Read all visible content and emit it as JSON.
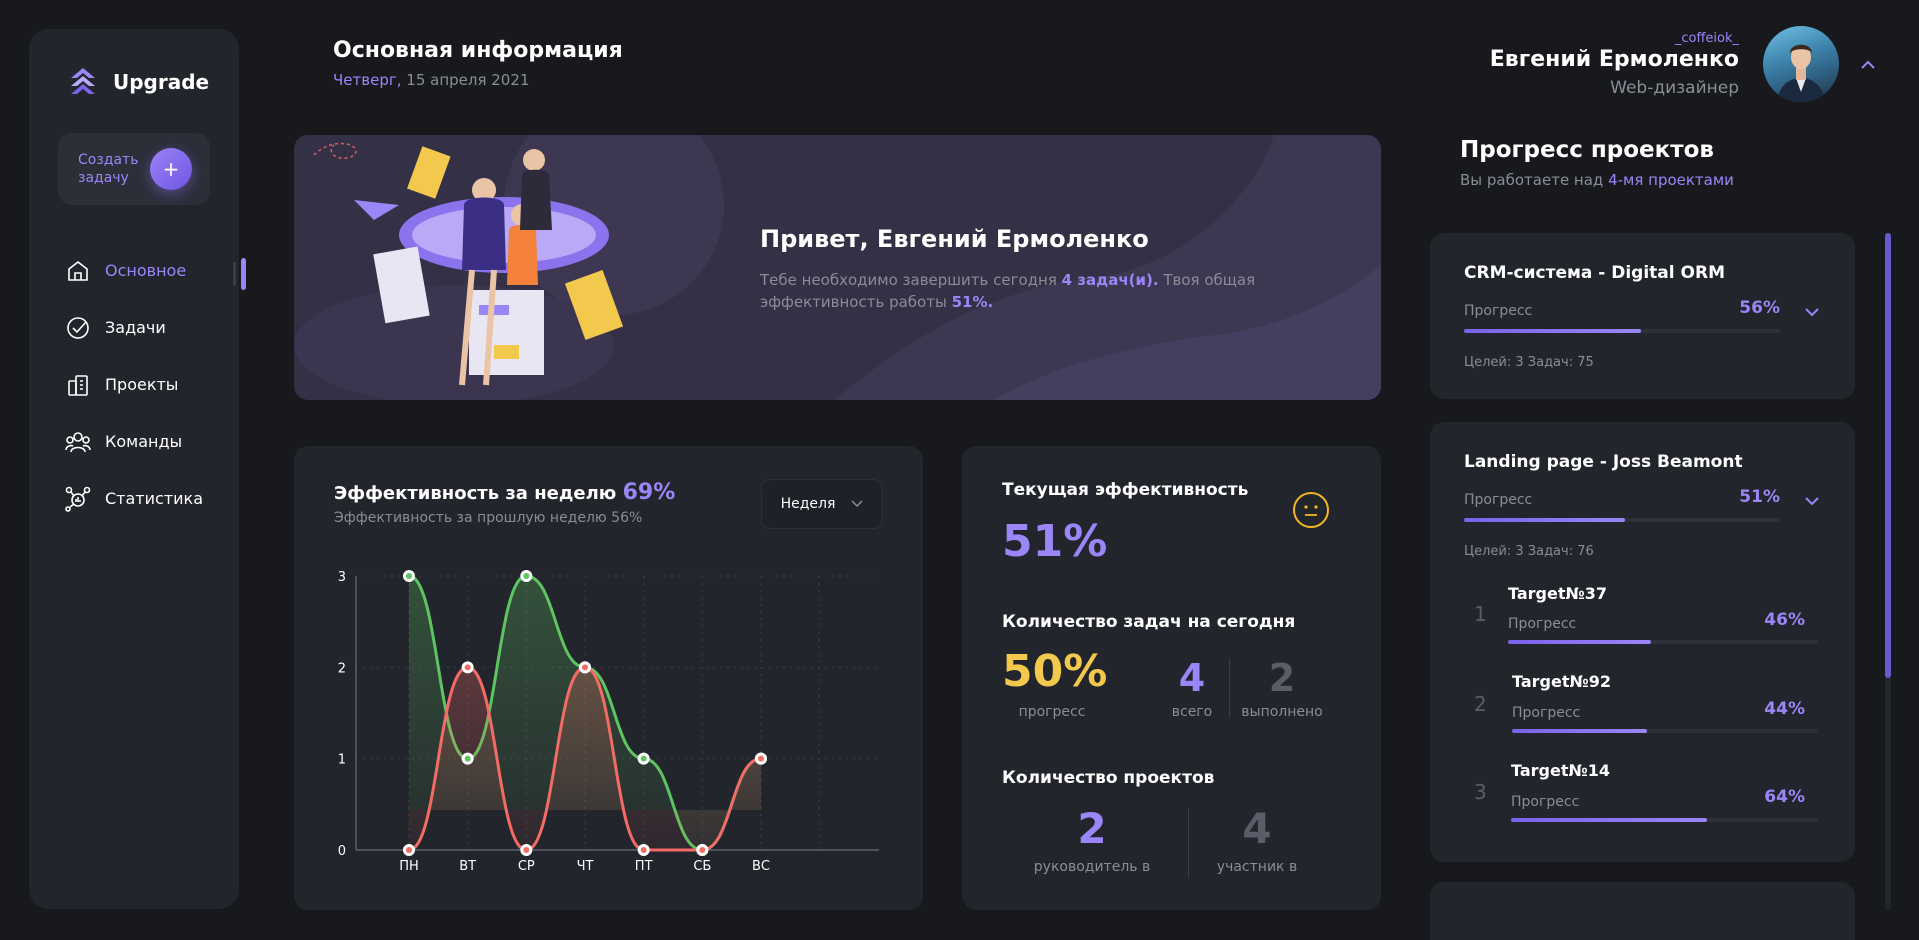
{
  "sidebar": {
    "logo_text": "Upgrade",
    "create_task_label": "Создать задачу",
    "create_task_icon": "+",
    "items": [
      {
        "label": "Основное",
        "icon": "home-icon",
        "active": true
      },
      {
        "label": "Задачи",
        "icon": "check-circle-icon",
        "active": false
      },
      {
        "label": "Проекты",
        "icon": "chart-building-icon",
        "active": false
      },
      {
        "label": "Команды",
        "icon": "team-icon",
        "active": false
      },
      {
        "label": "Статистика",
        "icon": "statistics-icon",
        "active": false
      }
    ]
  },
  "header": {
    "title": "Основная информация",
    "day": "Четверг,",
    "date": "15 апреля 2021"
  },
  "user": {
    "handle": "_coffeiok_",
    "name": "Евгений Ермоленко",
    "role": "Web-дизайнер"
  },
  "hero": {
    "greeting": "Привет, Евгений Ермоленко",
    "text_before": "Тебе необходимо завершить сегодня ",
    "tasks_count": "4 задач(и).",
    "text_middle": " Твоя общая эффективность работы ",
    "efficiency": "51%."
  },
  "efficiency_chart": {
    "title": "Эффективность за неделю",
    "title_pct": "69%",
    "subtitle_label": "Эффективность за прошлую неделю",
    "subtitle_pct": "56%",
    "period_select": "Неделя"
  },
  "chart_data": {
    "type": "line",
    "categories": [
      "ПН",
      "ВТ",
      "СР",
      "ЧТ",
      "ПТ",
      "СБ",
      "ВС"
    ],
    "ylim": [
      0,
      3
    ],
    "yticks": [
      "0",
      "1",
      "2",
      "3"
    ],
    "series": [
      {
        "color": "#5ec461",
        "values": [
          3,
          1,
          3,
          2,
          1,
          0,
          1
        ]
      },
      {
        "color": "#f26b65",
        "values": [
          0,
          2,
          0,
          2,
          0,
          0,
          1
        ]
      }
    ],
    "grid": true
  },
  "current": {
    "title": "Текущая эффективность",
    "pct": "51%",
    "mood_icon": "neutral-face-icon",
    "tasks_title": "Количество задач на сегодня",
    "progress_value": "50%",
    "progress_label": "прогресс",
    "total_value": "4",
    "total_label": "всего",
    "done_value": "2",
    "done_label": "выполнено",
    "projects_title": "Количество проектов",
    "lead_value": "2",
    "lead_label": "руководитель в",
    "member_value": "4",
    "member_label": "участник в"
  },
  "projects": {
    "title": "Прогресс проектов",
    "sub_before": "Вы работаете над ",
    "sub_count": "4-мя проектами",
    "items": [
      {
        "name": "CRM-система - Digital ORM",
        "progress_label": "Прогресс",
        "pct": "56%",
        "progress": 0.56,
        "meta": "Целей: 3   Задач: 75"
      },
      {
        "name": "Landing page - Joss Beamont",
        "progress_label": "Прогресс",
        "pct": "51%",
        "progress": 0.51,
        "meta": "Целей: 3   Задач: 76",
        "targets": [
          {
            "num": "1",
            "name": "Target№37",
            "progress_label": "Прогресс",
            "pct": "46%",
            "progress": 0.46
          },
          {
            "num": "2",
            "name": "Target№92",
            "progress_label": "Прогресс",
            "pct": "44%",
            "progress": 0.44
          },
          {
            "num": "3",
            "name": "Target№14",
            "progress_label": "Прогресс",
            "pct": "64%",
            "progress": 0.64
          }
        ]
      }
    ]
  },
  "colors": {
    "accent": "#9b86f8",
    "background": "#18191d",
    "card": "#23252c",
    "yellow": "#f2c94c",
    "green": "#5ec461",
    "red": "#f26b65"
  }
}
